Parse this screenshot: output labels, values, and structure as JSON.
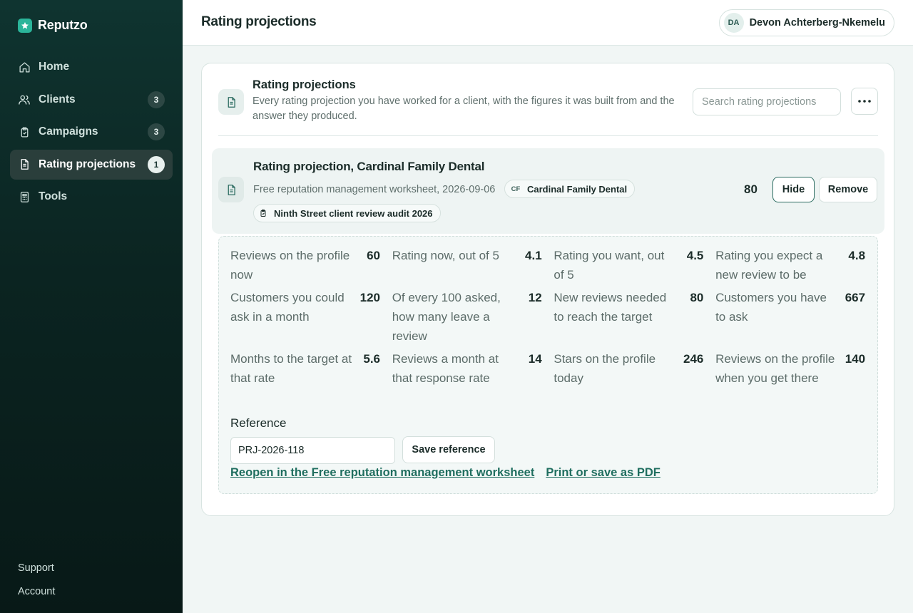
{
  "app": {
    "name": "Reputzo",
    "accent": "#2bb59a"
  },
  "sidebar": {
    "items": [
      {
        "label": "Home",
        "icon": "home-icon",
        "badge": ""
      },
      {
        "label": "Clients",
        "icon": "users-icon",
        "badge": "3"
      },
      {
        "label": "Campaigns",
        "icon": "clipboard-icon",
        "badge": "3"
      },
      {
        "label": "Rating projections",
        "icon": "document-icon",
        "badge": "1",
        "active": true
      },
      {
        "label": "Tools",
        "icon": "calculator-icon",
        "badge": ""
      }
    ],
    "footer": {
      "support": "Support",
      "account": "Account"
    }
  },
  "header": {
    "title": "Rating projections",
    "user": {
      "initials": "DA",
      "name": "Devon Achterberg-Nkemelu"
    }
  },
  "card": {
    "title": "Rating projections",
    "description": "Every rating projection you have worked for a client, with the figures it was built from and the answer they produced.",
    "search_placeholder": "Search rating projections"
  },
  "projection": {
    "title": "Rating projection, Cardinal Family Dental",
    "subtitle": "Free reputation management worksheet, 2026-09-06",
    "client_tag": {
      "initials": "CF",
      "label": "Cardinal Family Dental"
    },
    "campaign_tag": {
      "label": "Ninth Street client review audit 2026"
    },
    "count": "80",
    "hide_label": "Hide",
    "remove_label": "Remove"
  },
  "metrics": [
    {
      "label": "Reviews on the profile now",
      "value": "60"
    },
    {
      "label": "Rating now, out of 5",
      "value": "4.1"
    },
    {
      "label": "Rating you want, out of 5",
      "value": "4.5"
    },
    {
      "label": "Rating you expect a new review to be",
      "value": "4.8"
    },
    {
      "label": "Customers you could ask in a month",
      "value": "120"
    },
    {
      "label": "Of every 100 asked, how many leave a review",
      "value": "12"
    },
    {
      "label": "New reviews needed to reach the target",
      "value": "80"
    },
    {
      "label": "Customers you have to ask",
      "value": "667"
    },
    {
      "label": "Months to the target at that rate",
      "value": "5.6"
    },
    {
      "label": "Reviews a month at that response rate",
      "value": "14"
    },
    {
      "label": "Stars on the profile today",
      "value": "246"
    },
    {
      "label": "Reviews on the profile when you get there",
      "value": "140"
    }
  ],
  "reference": {
    "label": "Reference",
    "value": "PRJ-2026-118",
    "save_label": "Save reference"
  },
  "links": {
    "reopen": "Reopen in the Free reputation management worksheet",
    "print": "Print or save as PDF"
  }
}
